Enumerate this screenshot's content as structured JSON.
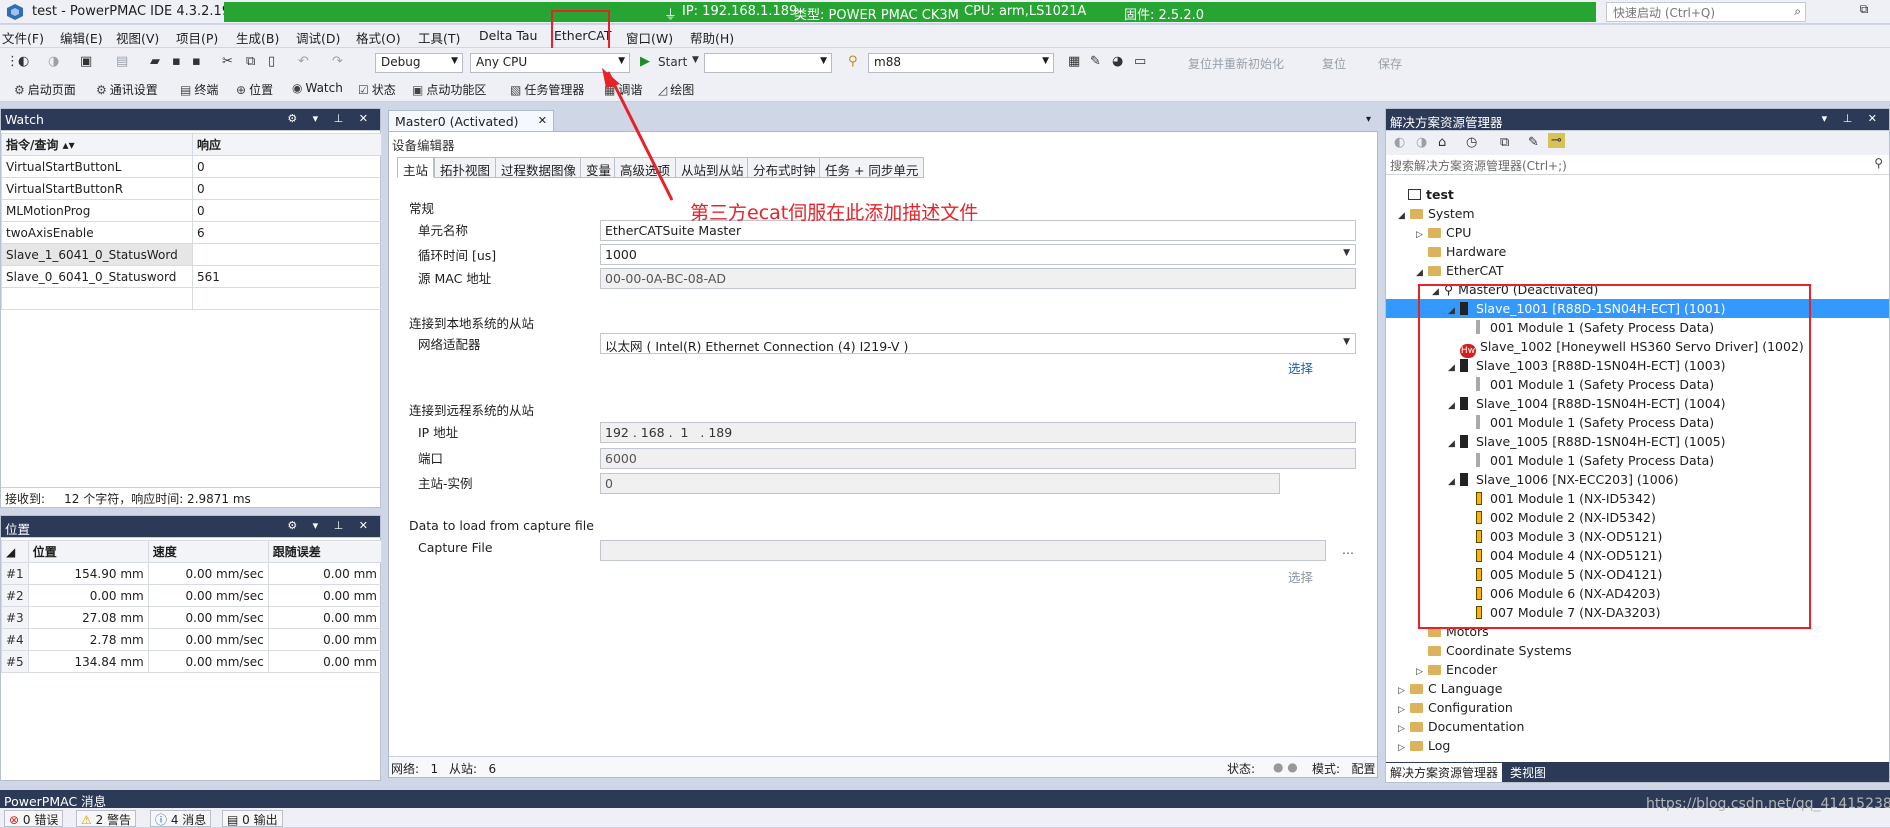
{
  "window": {
    "title": "test - PowerPMAC IDE 4.3.2.19",
    "status_ip": "IP: 192.168.1.189",
    "status_type": "类型: POWER PMAC CK3M",
    "status_cpu": "CPU: arm,LS1021A",
    "status_fw": "固件: 2.5.2.0",
    "quick_launch_placeholder": "快速启动 (Ctrl+Q)",
    "restore_glyph": "⧉"
  },
  "menu": [
    "文件(F)",
    "编辑(E)",
    "视图(V)",
    "项目(P)",
    "生成(B)",
    "调试(D)",
    "格式(O)",
    "工具(T)",
    "Delta Tau",
    "EtherCAT",
    "窗口(W)",
    "帮助(H)"
  ],
  "toolbar1": {
    "config": "Debug",
    "platform": "Any CPU",
    "start": "Start",
    "target": "",
    "project": "m88",
    "reset_reinit": "复位并重新初始化",
    "reset": "复位",
    "save": "保存"
  },
  "toolbar2": [
    "启动页面",
    "通讯设置",
    "终端",
    "位置",
    "Watch",
    "状态",
    "点动功能区",
    "任务管理器",
    "调谐",
    "绘图"
  ],
  "watch": {
    "title": "Watch",
    "col_cmd": "指令/查询 ▴▾",
    "col_resp": "响应",
    "rows": [
      {
        "cmd": "VirtualStartButtonL",
        "resp": "0"
      },
      {
        "cmd": "VirtualStartButtonR",
        "resp": "0"
      },
      {
        "cmd": "MLMotionProg",
        "resp": "0"
      },
      {
        "cmd": "twoAxisEnable",
        "resp": "6"
      },
      {
        "cmd": "Slave_1_6041_0_StatusWord",
        "resp": ""
      },
      {
        "cmd": "Slave_0_6041_0_Statusword",
        "resp": "561"
      }
    ],
    "footer": "接收到:     12 个字符，响应时间: 2.9871 ms"
  },
  "position": {
    "title": "位置",
    "col_pos": "位置",
    "col_vel": "速度",
    "col_err": "跟随误差",
    "rows": [
      {
        "idx": "#1",
        "pos": "154.90 mm",
        "vel": "0.00 mm/sec",
        "err": "0.00 mm"
      },
      {
        "idx": "#2",
        "pos": "0.00 mm",
        "vel": "0.00 mm/sec",
        "err": "0.00 mm"
      },
      {
        "idx": "#3",
        "pos": "27.08 mm",
        "vel": "0.00 mm/sec",
        "err": "0.00 mm"
      },
      {
        "idx": "#4",
        "pos": "2.78 mm",
        "vel": "0.00 mm/sec",
        "err": "0.00 mm"
      },
      {
        "idx": "#5",
        "pos": "134.84 mm",
        "vel": "0.00 mm/sec",
        "err": "0.00 mm"
      }
    ]
  },
  "editor": {
    "tab_label": "Master0 (Activated)",
    "header": "设备编辑器",
    "subtabs": [
      "主站",
      "拓扑视图",
      "过程数据图像",
      "变量",
      "高级选项",
      "从站到从站",
      "分布式时钟",
      "任务 + 同步单元"
    ],
    "general": "常规",
    "unit_name_label": "单元名称",
    "unit_name_value": "EtherCATSuite Master",
    "cycle_label": "循环时间 [us]",
    "cycle_value": "1000",
    "mac_label": "源 MAC 地址",
    "mac_value": "00-00-0A-BC-08-AD",
    "local_section": "连接到本地系统的从站",
    "adapter_label": "网络适配器",
    "adapter_value": "以太网 ( Intel(R) Ethernet Connection (4) I219-V )",
    "select1": "选择",
    "remote_section": "连接到远程系统的从站",
    "ip_label": "IP 地址",
    "ip_value": "192 . 168 .  1   . 189",
    "port_label": "端口",
    "port_value": "6000",
    "instance_label": "主站-实例",
    "instance_value": "0",
    "capture_section": "Data to load from capture file",
    "capture_label": "Capture File",
    "capture_value": "",
    "dots": "...",
    "select2": "选择",
    "status_net": "网络:   1",
    "status_slaves": "从站:   6",
    "status_state": "状态:",
    "status_mode": "模式:   配置"
  },
  "annotation": "第三方ecat伺服在此添加描述文件",
  "solution": {
    "title": "解决方案资源管理器",
    "search_placeholder": "搜索解决方案资源管理器(Ctrl+;)",
    "tree": [
      {
        "label": "test"
      },
      {
        "label": "System"
      },
      {
        "label": "CPU"
      },
      {
        "label": "Hardware"
      },
      {
        "label": "EtherCAT"
      },
      {
        "label": "Master0 (Deactivated)"
      },
      {
        "label": "Slave_1001 [R88D-1SN04H-ECT] (1001)"
      },
      {
        "label": "001 Module 1 (Safety Process Data)"
      },
      {
        "label": "Slave_1002 [Honeywell HS360 Servo Driver] (1002)"
      },
      {
        "label": "Slave_1003 [R88D-1SN04H-ECT] (1003)"
      },
      {
        "label": "001 Module 1 (Safety Process Data)"
      },
      {
        "label": "Slave_1004 [R88D-1SN04H-ECT] (1004)"
      },
      {
        "label": "001 Module 1 (Safety Process Data)"
      },
      {
        "label": "Slave_1005 [R88D-1SN04H-ECT] (1005)"
      },
      {
        "label": "001 Module 1 (Safety Process Data)"
      },
      {
        "label": "Slave_1006 [NX-ECC203] (1006)"
      },
      {
        "label": "001 Module 1 (NX-ID5342)"
      },
      {
        "label": "002 Module 2 (NX-ID5342)"
      },
      {
        "label": "003 Module 3 (NX-OD5121)"
      },
      {
        "label": "004 Module 4 (NX-OD5121)"
      },
      {
        "label": "005 Module 5 (NX-OD4121)"
      },
      {
        "label": "006 Module 6 (NX-AD4203)"
      },
      {
        "label": "007 Module 7 (NX-DA3203)"
      },
      {
        "label": "Motors"
      },
      {
        "label": "Coordinate Systems"
      },
      {
        "label": "Encoder"
      },
      {
        "label": "C Language"
      },
      {
        "label": "Configuration"
      },
      {
        "label": "Documentation"
      },
      {
        "label": "Log"
      }
    ],
    "tab1": "解决方案资源管理器",
    "tab2": "类视图"
  },
  "messages": {
    "title": "PowerPMAC 消息",
    "errors": "0 错误",
    "warnings": "2 警告",
    "infos": "4 消息",
    "output": "0 输出"
  },
  "watermark": "https://blog.csdn.net/qq_41415238",
  "colors": {
    "status_green": "#27a532",
    "annotation_red": "#e52329",
    "selection_blue": "#3399ff",
    "panel_dark": "#2c3a57"
  }
}
